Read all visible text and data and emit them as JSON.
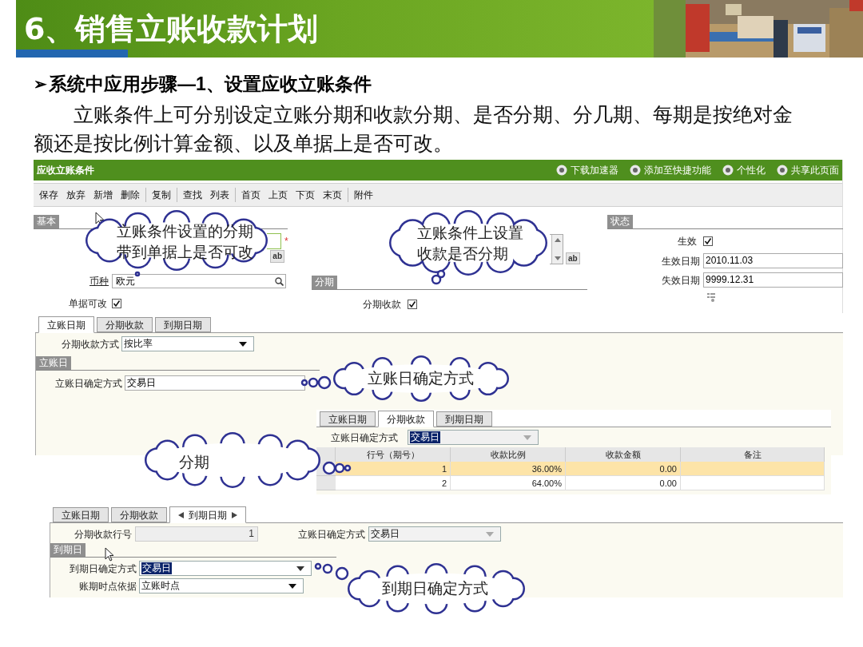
{
  "slide": {
    "title": "6、销售立账收款计划",
    "bullet": "➢",
    "heading": "系统中应用步骤—1、设置应收立账条件",
    "intro": "立账条件上可分别设定立账分期和收款分期、是否分期、分几期、每期是按绝对金额还是按比例计算金额、以及单据上是否可改。"
  },
  "form": {
    "title": "应收立账条件",
    "header_links": [
      "下载加速器",
      "添加至快捷功能",
      "个性化",
      "共享此页面"
    ],
    "toolbar_groups": [
      [
        "保存",
        "放弃",
        "新增",
        "删除"
      ],
      [
        "复制"
      ],
      [
        "查找",
        "列表"
      ],
      [
        "首页",
        "上页",
        "下页",
        "末页"
      ],
      [
        "附件"
      ]
    ],
    "basic": {
      "label": "基本",
      "required_mark": "*",
      "memo_button": "ab",
      "currency_label": "币种",
      "currency_value": "欧元",
      "editable_label": "单据可改",
      "editable_checked": true
    },
    "installment": {
      "label": "分期",
      "memo_button": "ab",
      "field_label": "分期收款",
      "checked": true
    },
    "status": {
      "label": "状态",
      "effective_label": "生效",
      "effective_checked": true,
      "dates": [
        {
          "label": "生效日期",
          "value": "2010.11.03"
        },
        {
          "label": "失效日期",
          "value": "9999.12.31"
        }
      ]
    }
  },
  "panel1": {
    "tabs": [
      {
        "label": "立账日期",
        "selected": true
      },
      {
        "label": "分期收款",
        "selected": false
      },
      {
        "label": "到期日期",
        "selected": false
      }
    ],
    "method_label": "分期收款方式",
    "method_value": "按比率",
    "section": "立账日",
    "date_label": "立账日确定方式",
    "date_value": "交易日"
  },
  "panel2": {
    "tabs": [
      {
        "label": "立账日期",
        "selected": false
      },
      {
        "label": "分期收款",
        "selected": true
      },
      {
        "label": "到期日期",
        "selected": false
      }
    ],
    "date_label": "立账日确定方式",
    "date_value": "交易日",
    "value_selected": true,
    "columns": [
      "行号（期号）",
      "收款比例",
      "收款金额",
      "备注"
    ],
    "rows": [
      {
        "cells": [
          "1",
          "36.00%",
          "0.00"
        ],
        "selected": true
      },
      {
        "cells": [
          "2",
          "64.00%",
          "0.00"
        ],
        "selected": false
      }
    ]
  },
  "panel3": {
    "tabs": [
      {
        "label": "立账日期",
        "selected": false
      },
      {
        "label": "分期收款",
        "selected": false
      },
      {
        "label": "到期日期",
        "selected": true
      }
    ],
    "row_label": "分期收款行号",
    "row_value": "1",
    "date_label": "立账日确定方式",
    "date_value": "交易日",
    "section": "到期日",
    "due_label": "到期日确定方式",
    "due_value": "交易日",
    "value_selected": true,
    "basis_label": "账期时点依据",
    "basis_value": "立账时点"
  },
  "callouts": [
    {
      "lines": [
        "立账条件设置的分期",
        "带到单据上是否可改"
      ]
    },
    {
      "lines": [
        "立账条件上设置",
        "收款是否分期"
      ]
    },
    {
      "lines": [
        "立账日确定方式"
      ]
    },
    {
      "lines": [
        "分期"
      ]
    },
    {
      "lines": [
        "到期日确定方式"
      ]
    }
  ]
}
